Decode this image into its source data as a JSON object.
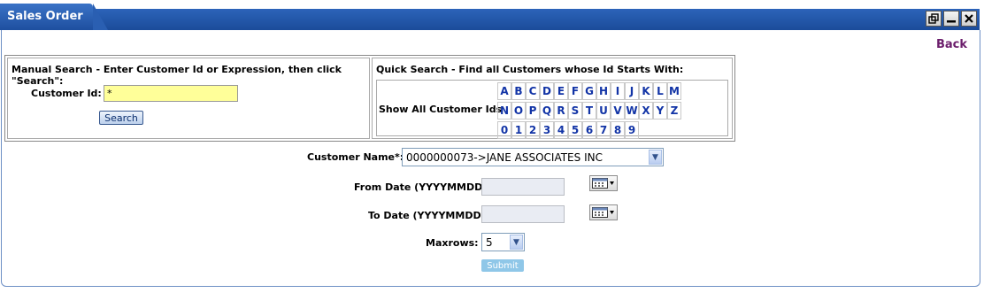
{
  "window": {
    "title": "Sales Order",
    "buttons": [
      "restore-icon",
      "minimize-icon",
      "close-icon"
    ]
  },
  "nav": {
    "back": "Back"
  },
  "manual_search": {
    "heading": "Manual Search - Enter Customer Id or Expression, then click \"Search\":",
    "customer_id_label": "Customer Id:",
    "customer_id_value": "*",
    "search_button": "Search"
  },
  "quick_search": {
    "heading": "Quick Search - Find all Customers whose Id Starts With:",
    "show_all": "Show All Customer Ids",
    "rows": [
      [
        "A",
        "B",
        "C",
        "D",
        "E",
        "F",
        "G",
        "H",
        "I",
        "J",
        "K",
        "L",
        "M"
      ],
      [
        "N",
        "O",
        "P",
        "Q",
        "R",
        "S",
        "T",
        "U",
        "V",
        "W",
        "X",
        "Y",
        "Z"
      ],
      [
        "0",
        "1",
        "2",
        "3",
        "4",
        "5",
        "6",
        "7",
        "8",
        "9"
      ]
    ]
  },
  "form": {
    "customer_name_label": "Customer Name*:",
    "customer_name_value": "0000000073->JANE ASSOCIATES INC",
    "from_date_label": "From Date (YYYYMMDD):",
    "from_date_value": "",
    "to_date_label": "To Date (YYYYMMDD):",
    "to_date_value": "",
    "maxrows_label": "Maxrows:",
    "maxrows_value": "5",
    "submit": "Submit"
  },
  "colors": {
    "title_bar": "#1e4f9f",
    "link": "#6b1d6b",
    "letter": "#1234a6",
    "input_highlight": "#ffff99"
  }
}
